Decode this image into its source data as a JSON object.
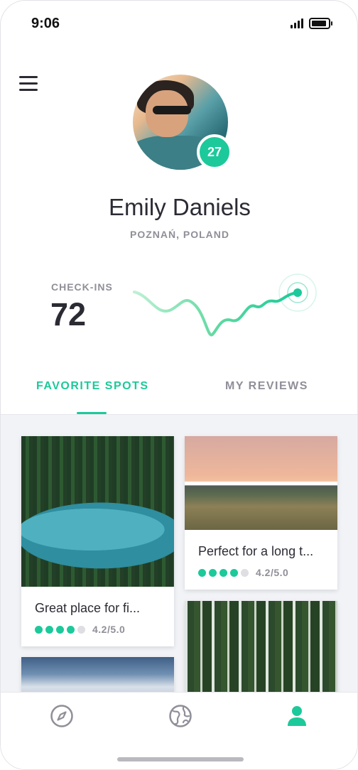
{
  "status_bar": {
    "time": "9:06"
  },
  "profile": {
    "name": "Emily Daniels",
    "location": "POZNAŃ, POLAND",
    "badge_count": "27"
  },
  "stats": {
    "checkins_label": "CHECK-INS",
    "checkins_value": "72"
  },
  "tabs": [
    {
      "label": "FAVORITE SPOTS",
      "active": true
    },
    {
      "label": "MY REVIEWS",
      "active": false
    }
  ],
  "cards": [
    {
      "title": "Great place for fi...",
      "score": "4.2/5.0",
      "rating": 4,
      "max_rating": 5
    },
    {
      "title": "Perfect for a long t...",
      "score": "4.2/5.0",
      "rating": 4,
      "max_rating": 5
    }
  ],
  "bottom_nav": {
    "items": [
      {
        "icon": "compass-icon",
        "active": false
      },
      {
        "icon": "globe-icon",
        "active": false
      },
      {
        "icon": "user-icon",
        "active": true
      }
    ]
  },
  "colors": {
    "accent": "#1cc99a",
    "text_primary": "#2b2b34",
    "text_secondary": "#8f8f99",
    "feed_background": "#f2f3f7"
  }
}
